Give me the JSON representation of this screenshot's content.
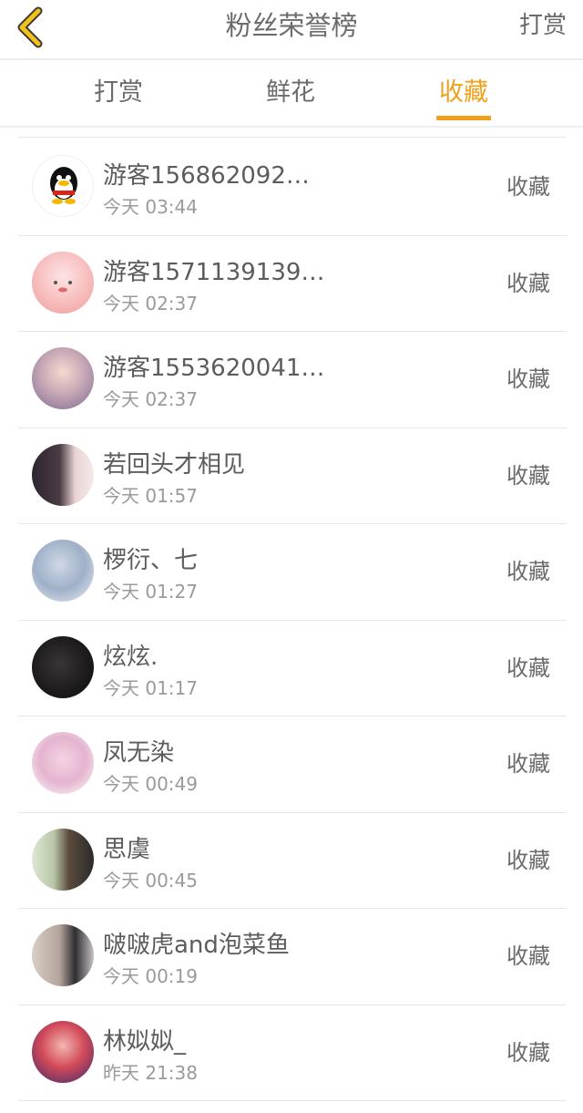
{
  "header": {
    "title": "粉丝荣誉榜",
    "right_action": "打赏",
    "accent_color": "#f0a11a",
    "back_icon": "chevron-left-icon"
  },
  "tabs": [
    {
      "label": "打赏",
      "active": false
    },
    {
      "label": "鲜花",
      "active": false
    },
    {
      "label": "收藏",
      "active": true
    }
  ],
  "rows": [
    {
      "name": "游客156862092…",
      "time": "今天 03:44",
      "action": "收藏",
      "avatar_icon": "penguin-avatar"
    },
    {
      "name": "游客1571139139…",
      "time": "今天 02:37",
      "action": "收藏",
      "avatar_icon": "pink-cartoon-avatar"
    },
    {
      "name": "游客1553620041…",
      "time": "今天 02:37",
      "action": "收藏",
      "avatar_icon": "photo-avatar"
    },
    {
      "name": "若回头才相见",
      "time": "今天 01:57",
      "action": "收藏",
      "avatar_icon": "anime-girl-avatar"
    },
    {
      "name": "椤衍、七",
      "time": "今天 01:27",
      "action": "收藏",
      "avatar_icon": "illustration-avatar"
    },
    {
      "name": "炫炫.",
      "time": "今天 01:17",
      "action": "收藏",
      "avatar_icon": "dark-photo-avatar"
    },
    {
      "name": "凤无染",
      "time": "今天 00:49",
      "action": "收藏",
      "avatar_icon": "anime-girl-avatar"
    },
    {
      "name": "思虞",
      "time": "今天 00:45",
      "action": "收藏",
      "avatar_icon": "comic-avatar"
    },
    {
      "name": "啵啵虎and泡菜鱼",
      "time": "今天 00:19",
      "action": "收藏",
      "avatar_icon": "couple-photo-avatar"
    },
    {
      "name": "林姒姒_",
      "time": "昨天 21:38",
      "action": "收藏",
      "avatar_icon": "portrait-avatar"
    }
  ]
}
